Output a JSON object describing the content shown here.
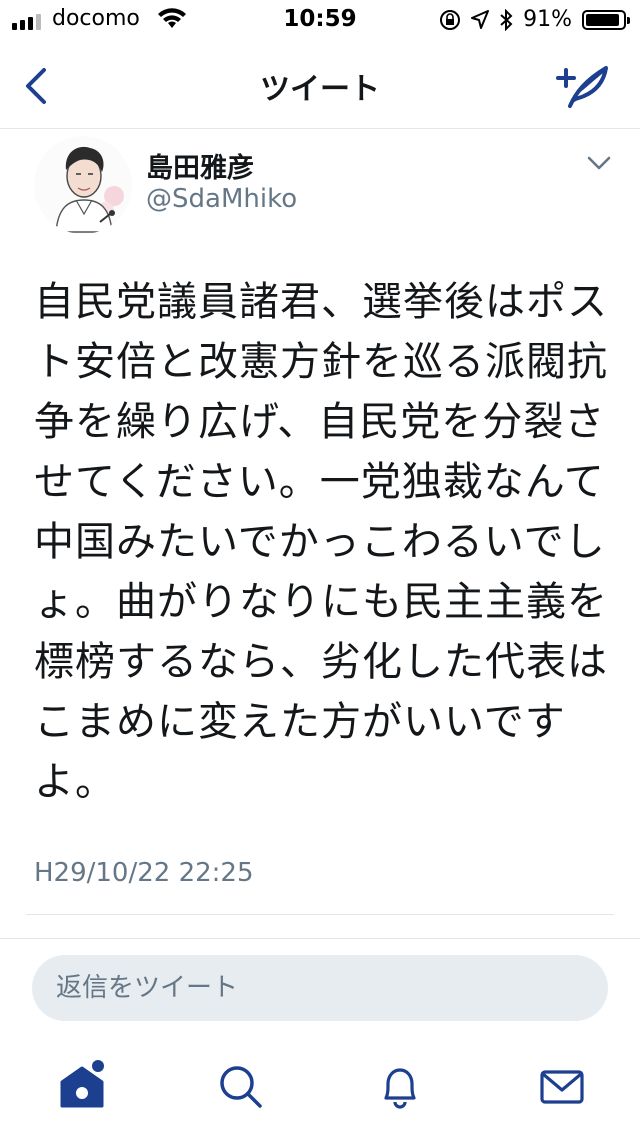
{
  "status_bar": {
    "carrier": "docomo",
    "time": "10:59",
    "battery": "91%",
    "battery_level": 0.91
  },
  "nav": {
    "title": "ツイート",
    "back_icon": "chevron-left-icon",
    "compose_icon": "compose-tweet-icon"
  },
  "tweet": {
    "author_name": "島田雅彦",
    "author_handle": "@SdaMhiko",
    "text": "自民党議員諸君、選挙後はポスト安倍と改憲方針を巡る派閥抗争を繰り広げ、自民党を分裂させてください。一党独裁なんて中国みたいでかっこわるいでしょ。曲がりなりにも民主主義を標榜するなら、劣化した代表はこまめに変えた方がいいですよ。",
    "timestamp": "H29/10/22 22:25"
  },
  "reply": {
    "placeholder": "返信をツイート"
  },
  "tabs": [
    {
      "icon": "home-icon",
      "active": true,
      "has_notification_dot": true
    },
    {
      "icon": "search-icon",
      "active": false
    },
    {
      "icon": "bell-icon",
      "active": false
    },
    {
      "icon": "mail-icon",
      "active": false
    }
  ],
  "colors": {
    "accent": "#1d3f8f",
    "text": "#14171a",
    "secondary_text": "#657786",
    "reply_bg": "#e6ecf0",
    "divider": "#e1e8ed"
  }
}
